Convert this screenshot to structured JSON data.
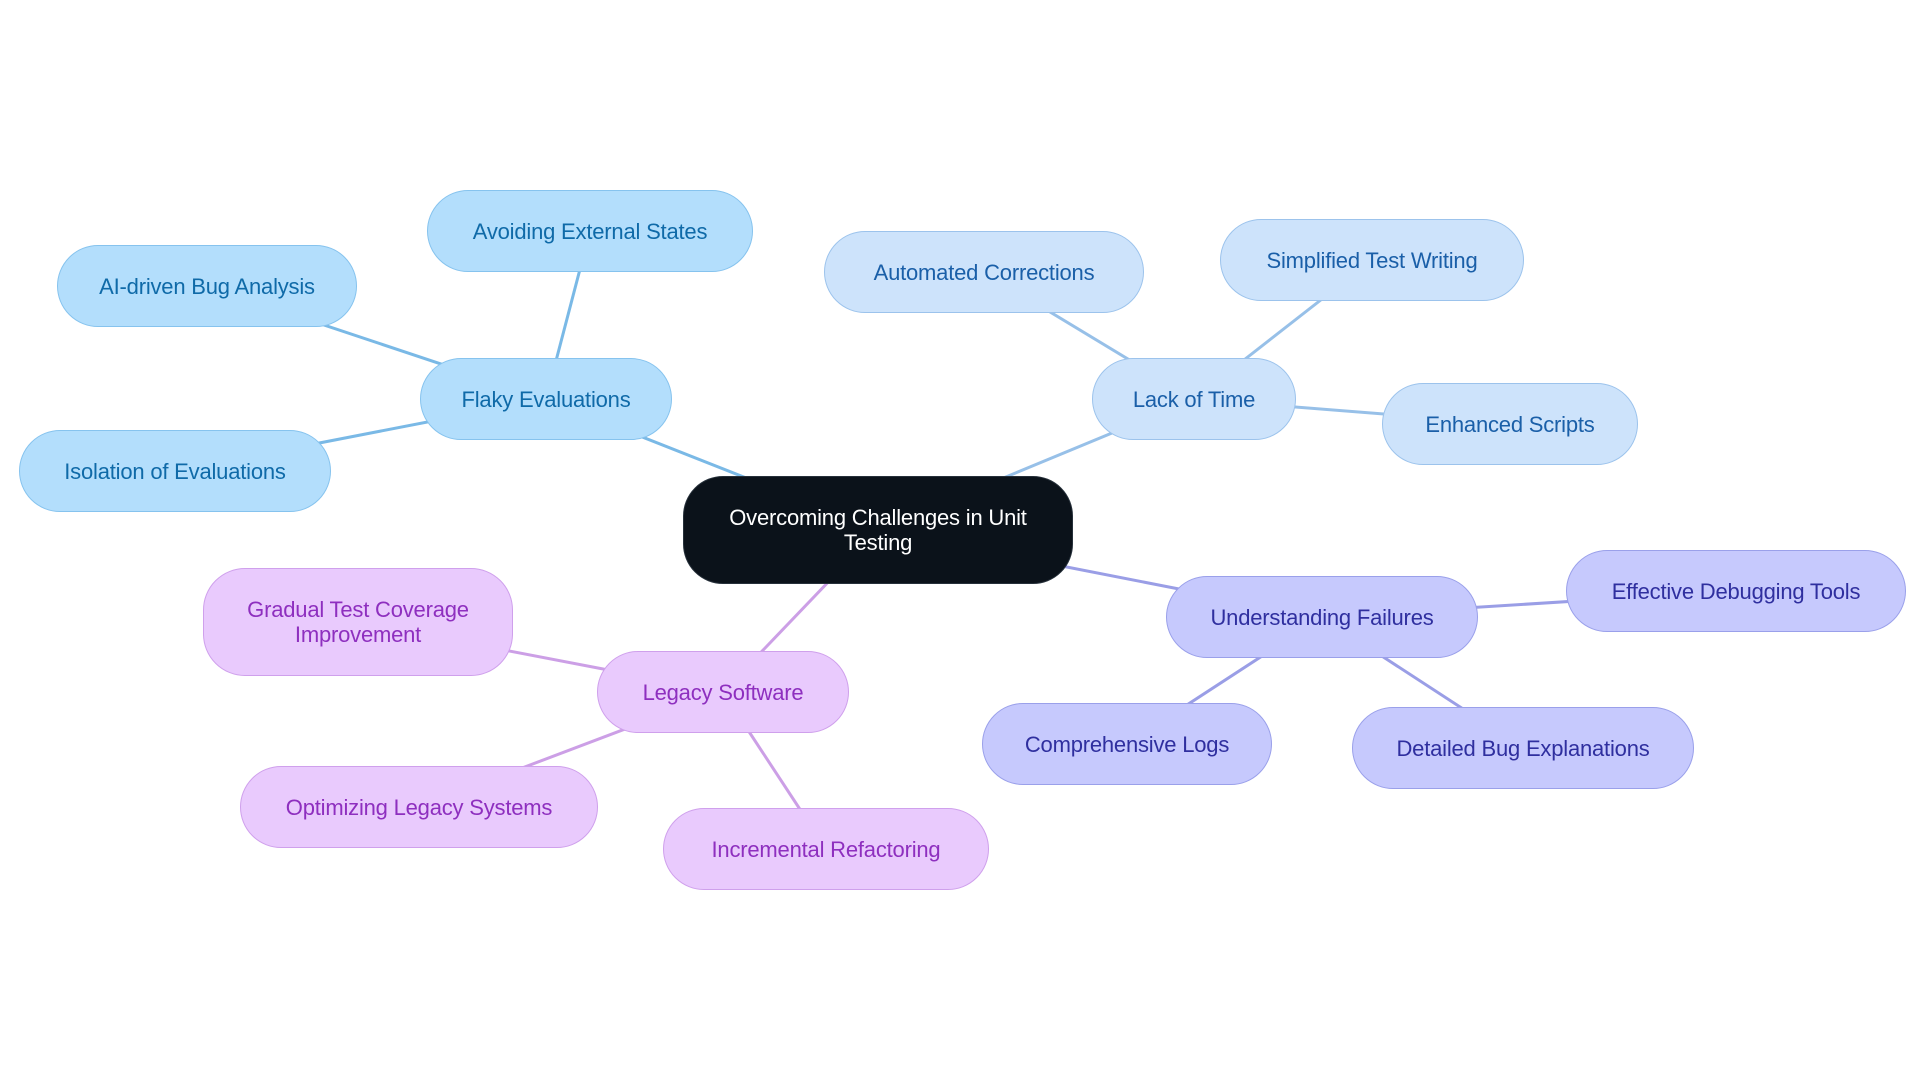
{
  "title": "Overcoming Challenges in Unit Testing",
  "themes": {
    "root": {
      "fill": "#0b121a",
      "stroke": "#26303a",
      "text": "#ffffff",
      "edge": "#000000"
    },
    "sky": {
      "fill": "#b3defc",
      "stroke": "#86c3ee",
      "text": "#0f6aa8",
      "edge": "#7ab9e6"
    },
    "blue": {
      "fill": "#cde3fb",
      "stroke": "#9cc3ec",
      "text": "#1a5fa8",
      "edge": "#97c0e8"
    },
    "indigo": {
      "fill": "#c6c9fd",
      "stroke": "#9aa0ea",
      "text": "#2f2f9f",
      "edge": "#9a9ee6"
    },
    "purple": {
      "fill": "#e9cafd",
      "stroke": "#cfa0ec",
      "text": "#8e2fbf",
      "edge": "#cc9fe6"
    }
  },
  "mindmap": {
    "root": {
      "id": "root",
      "label": "Overcoming Challenges in Unit Testing",
      "theme": "root"
    },
    "branches": [
      {
        "id": "flaky",
        "label": "Flaky Evaluations",
        "theme": "sky",
        "children": [
          {
            "id": "avoid",
            "label": "Avoiding External States"
          },
          {
            "id": "ai",
            "label": "AI-driven Bug Analysis"
          },
          {
            "id": "iso",
            "label": "Isolation of Evaluations"
          }
        ]
      },
      {
        "id": "time",
        "label": "Lack of Time",
        "theme": "blue",
        "children": [
          {
            "id": "auto",
            "label": "Automated Corrections"
          },
          {
            "id": "simp",
            "label": "Simplified Test Writing"
          },
          {
            "id": "enh",
            "label": "Enhanced Scripts"
          }
        ]
      },
      {
        "id": "fail",
        "label": "Understanding Failures",
        "theme": "indigo",
        "children": [
          {
            "id": "debug",
            "label": "Effective Debugging Tools"
          },
          {
            "id": "logs",
            "label": "Comprehensive Logs"
          },
          {
            "id": "detail",
            "label": "Detailed Bug Explanations"
          }
        ]
      },
      {
        "id": "legacy",
        "label": "Legacy Software",
        "theme": "purple",
        "children": [
          {
            "id": "grad",
            "label": "Gradual Test Coverage Improvement"
          },
          {
            "id": "opt",
            "label": "Optimizing Legacy Systems"
          },
          {
            "id": "inc",
            "label": "Incremental Refactoring"
          }
        ]
      }
    ]
  }
}
